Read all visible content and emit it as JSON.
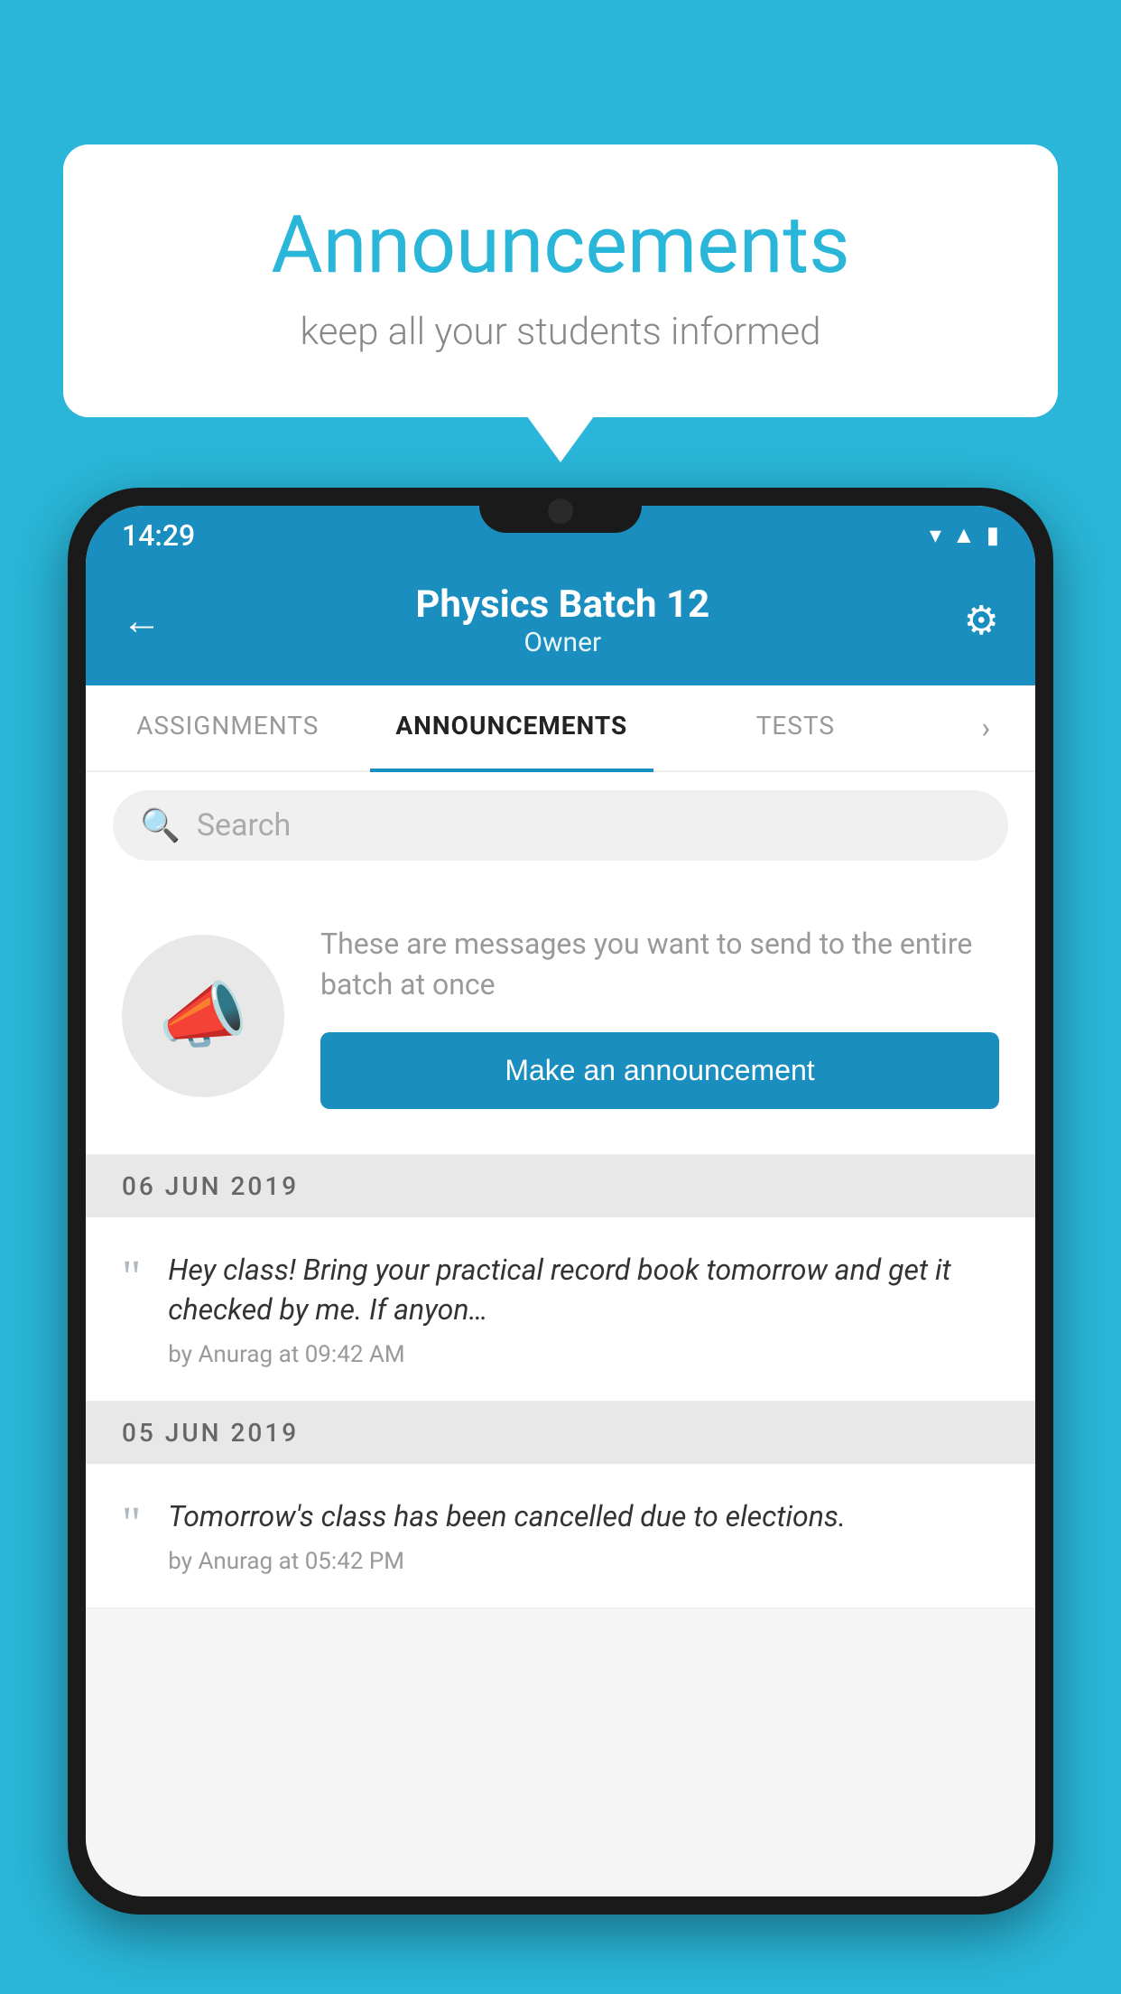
{
  "background_color": "#29b6d8",
  "speech_bubble": {
    "title": "Announcements",
    "subtitle": "keep all your students informed"
  },
  "status_bar": {
    "time": "14:29",
    "icons": [
      "wifi",
      "signal",
      "battery"
    ]
  },
  "header": {
    "title": "Physics Batch 12",
    "subtitle": "Owner",
    "back_label": "←",
    "gear_label": "⚙"
  },
  "tabs": [
    {
      "label": "ASSIGNMENTS",
      "active": false
    },
    {
      "label": "ANNOUNCEMENTS",
      "active": true
    },
    {
      "label": "TESTS",
      "active": false
    },
    {
      "label": "›",
      "active": false
    }
  ],
  "search": {
    "placeholder": "Search"
  },
  "empty_state": {
    "description": "These are messages you want to send to the entire batch at once",
    "button_label": "Make an announcement"
  },
  "announcements": [
    {
      "date": "06  JUN  2019",
      "text": "Hey class! Bring your practical record book tomorrow and get it checked by me. If anyon…",
      "meta": "by Anurag at 09:42 AM"
    },
    {
      "date": "05  JUN  2019",
      "text": "Tomorrow's class has been cancelled due to elections.",
      "meta": "by Anurag at 05:42 PM"
    }
  ]
}
